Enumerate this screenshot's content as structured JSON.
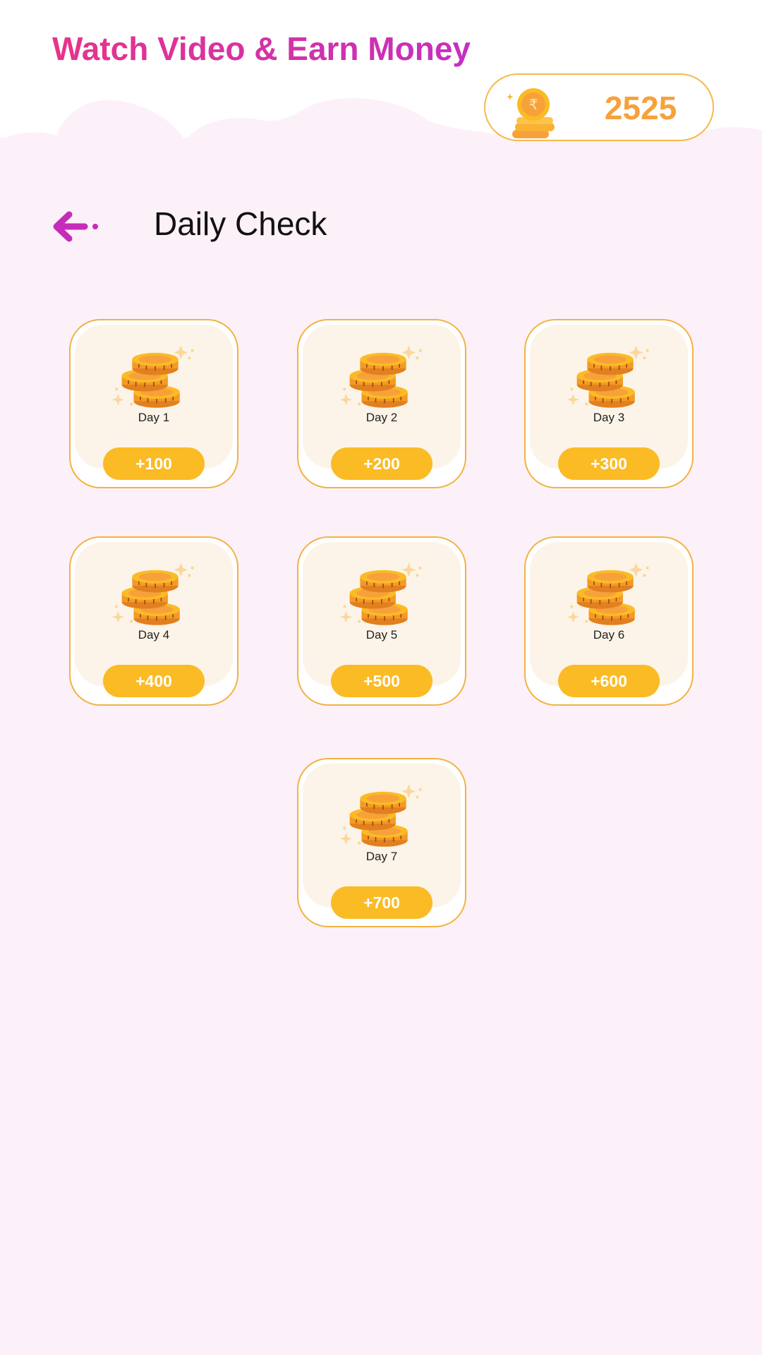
{
  "header": {
    "app_title": "Watch Video & Earn Money",
    "balance": "2525",
    "balance_icon": "rupee-coin-stack-icon"
  },
  "page": {
    "title": "Daily Check",
    "back_icon": "arrow-left-icon"
  },
  "days": [
    {
      "label": "Day 1",
      "reward": "+100"
    },
    {
      "label": "Day 2",
      "reward": "+200"
    },
    {
      "label": "Day 3",
      "reward": "+300"
    },
    {
      "label": "Day 4",
      "reward": "+400"
    },
    {
      "label": "Day 5",
      "reward": "+500"
    },
    {
      "label": "Day 6",
      "reward": "+600"
    },
    {
      "label": "Day 7",
      "reward": "+700"
    }
  ],
  "colors": {
    "title_gradient_start": "#e6348a",
    "title_gradient_end": "#c42fc1",
    "accent_orange": "#f7a13b",
    "reward_button": "#fbbb25",
    "background": "#fcf1f8",
    "card_inner": "#fcf4e8"
  }
}
